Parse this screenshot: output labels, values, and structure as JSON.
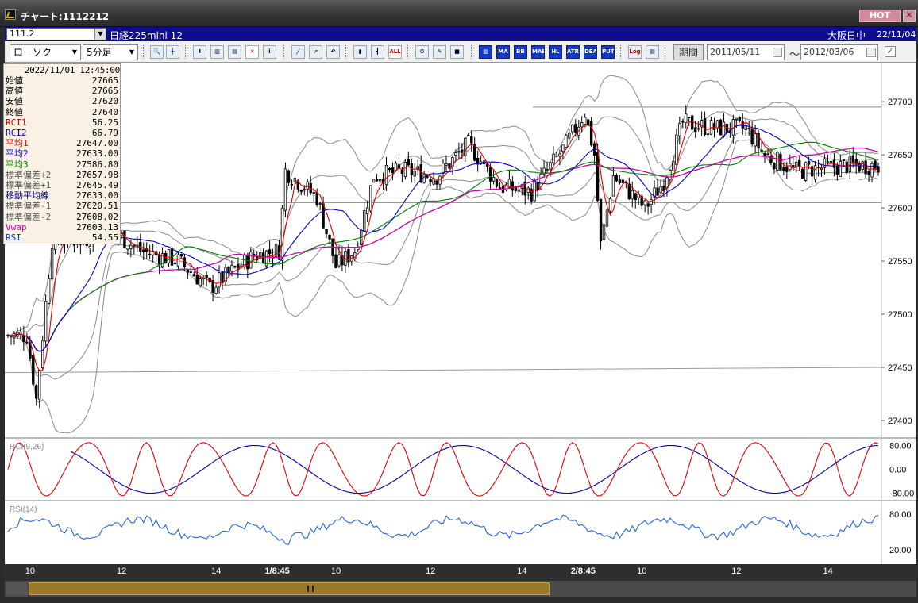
{
  "window": {
    "title": "チャート:1112212",
    "hot_label": "HOT",
    "close_label": "✕"
  },
  "symbol_bar": {
    "symbol_code": "111.2",
    "symbol_name": "日経225mini 12",
    "market": "大阪日中",
    "date": "22/11/04"
  },
  "toolbar": {
    "chart_type": "ローソク",
    "timeframe": "5分足",
    "period_label": "期間",
    "date_from": "2011/05/11",
    "date_to": "2012/03/06",
    "range_sep": "〜",
    "buttons": [
      "ALL",
      "MA",
      "BB",
      "MAE",
      "HL",
      "ATR",
      "DEA",
      "PUT",
      "Log"
    ]
  },
  "data_window": {
    "timestamp": "2022/11/01 12:45:00",
    "rows": [
      {
        "label": "始値",
        "value": "27665",
        "color": "#000000"
      },
      {
        "label": "高値",
        "value": "27665",
        "color": "#000000"
      },
      {
        "label": "安値",
        "value": "27620",
        "color": "#000000"
      },
      {
        "label": "終値",
        "value": "27640",
        "color": "#000000"
      },
      {
        "label": "RCI1",
        "value": "56.25",
        "color": "#cc0000"
      },
      {
        "label": "RCI2",
        "value": "66.79",
        "color": "#0000aa"
      },
      {
        "label": "平均1",
        "value": "27647.00",
        "color": "#dd0000"
      },
      {
        "label": "平均2",
        "value": "27633.00",
        "color": "#0000cc"
      },
      {
        "label": "平均3",
        "value": "27586.80",
        "color": "#008000"
      },
      {
        "label": "標準偏差+2",
        "value": "27657.98",
        "color": "#555555"
      },
      {
        "label": "標準偏差+1",
        "value": "27645.49",
        "color": "#555555"
      },
      {
        "label": "移動平均線",
        "value": "27633.00",
        "color": "#000080"
      },
      {
        "label": "標準偏差-1",
        "value": "27620.51",
        "color": "#555555"
      },
      {
        "label": "標準偏差-2",
        "value": "27608.02",
        "color": "#555555"
      },
      {
        "label": "Vwap",
        "value": "27603.13",
        "color": "#cc00aa"
      },
      {
        "label": "RSI",
        "value": "54.55",
        "color": "#0044cc"
      }
    ]
  },
  "chart_data": {
    "type": "candlestick",
    "price_axis": {
      "ticks": [
        27700,
        27650,
        27600,
        27550,
        27500,
        27450,
        27400
      ],
      "range": [
        27385,
        27730
      ]
    },
    "rci_panel": {
      "label": "RCI(9,26)",
      "ticks": [
        "80.00",
        "0.00",
        "-80.00"
      ],
      "range": [
        -100,
        100
      ]
    },
    "rsi_panel": {
      "label": "RSI(14)",
      "ticks": [
        "80.00",
        "20.00"
      ],
      "range": [
        0,
        100
      ]
    },
    "x_labels": [
      {
        "label": "10",
        "bar": 7,
        "bold": false
      },
      {
        "label": "12",
        "bar": 36,
        "bold": false
      },
      {
        "label": "14",
        "bar": 66,
        "bold": false
      },
      {
        "label": "1/8:45",
        "bar": 86,
        "bold": true
      },
      {
        "label": "10",
        "bar": 104,
        "bold": false
      },
      {
        "label": "12",
        "bar": 134,
        "bold": false
      },
      {
        "label": "14",
        "bar": 163,
        "bold": false
      },
      {
        "label": "2/8:45",
        "bar": 183,
        "bold": true
      },
      {
        "label": "10",
        "bar": 201,
        "bold": false
      },
      {
        "label": "12",
        "bar": 231,
        "bold": false
      },
      {
        "label": "14",
        "bar": 260,
        "bold": false
      }
    ],
    "close_anchors": [
      [
        0,
        27480
      ],
      [
        6,
        27480
      ],
      [
        9,
        27420
      ],
      [
        14,
        27570
      ],
      [
        24,
        27570
      ],
      [
        32,
        27580
      ],
      [
        42,
        27560
      ],
      [
        54,
        27550
      ],
      [
        64,
        27525
      ],
      [
        78,
        27555
      ],
      [
        86,
        27560
      ],
      [
        88,
        27635
      ],
      [
        98,
        27610
      ],
      [
        104,
        27545
      ],
      [
        110,
        27560
      ],
      [
        116,
        27630
      ],
      [
        126,
        27635
      ],
      [
        136,
        27630
      ],
      [
        146,
        27660
      ],
      [
        156,
        27620
      ],
      [
        166,
        27615
      ],
      [
        176,
        27655
      ],
      [
        183,
        27690
      ],
      [
        186,
        27650
      ],
      [
        188,
        27565
      ],
      [
        192,
        27630
      ],
      [
        202,
        27600
      ],
      [
        208,
        27625
      ],
      [
        214,
        27680
      ],
      [
        224,
        27675
      ],
      [
        234,
        27675
      ],
      [
        240,
        27650
      ],
      [
        250,
        27635
      ],
      [
        266,
        27640
      ],
      [
        276,
        27640
      ]
    ],
    "series": [
      {
        "name": "平均1",
        "color": "#dd0000"
      },
      {
        "name": "平均2",
        "color": "#0000cc"
      },
      {
        "name": "平均3",
        "color": "#008000"
      },
      {
        "name": "Vwap",
        "color": "#cc00aa"
      },
      {
        "name": "RCI1",
        "color": "#dd0000"
      },
      {
        "name": "RCI2",
        "color": "#0000aa"
      },
      {
        "name": "RSI",
        "color": "#2266dd"
      }
    ]
  }
}
